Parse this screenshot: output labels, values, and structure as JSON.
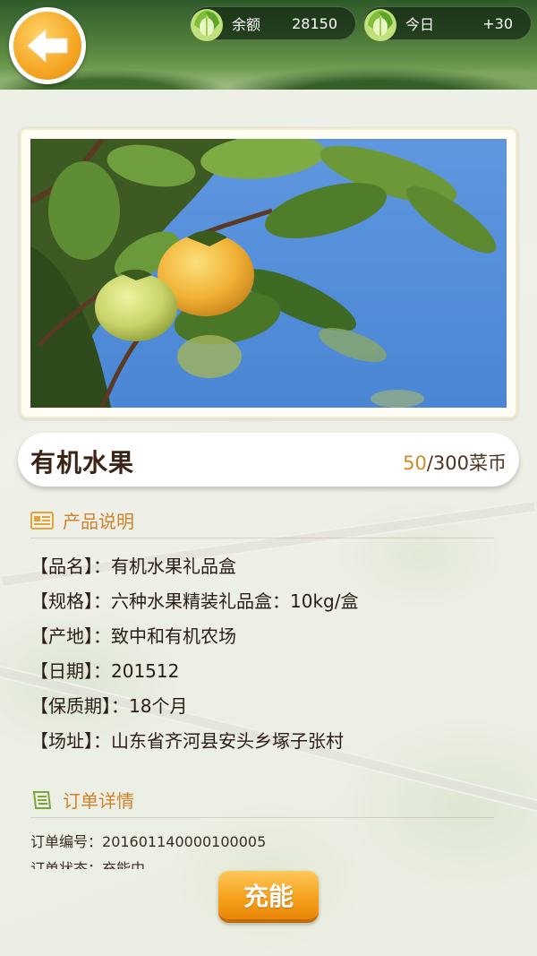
{
  "header": {
    "balance_label": "余额",
    "balance_value": "28150",
    "today_label": "今日",
    "today_value": "+30"
  },
  "product": {
    "name": "有机水果",
    "price_current": "50",
    "price_rest": "/300菜币"
  },
  "description": {
    "title": "产品说明",
    "rows": [
      {
        "key": "【品名】",
        "value": "有机水果礼品盒"
      },
      {
        "key": "【规格】",
        "value": "六种水果精装礼品盒：10kg/盒"
      },
      {
        "key": "【产地】",
        "value": "致中和有机农场"
      },
      {
        "key": "【日期】",
        "value": "201512"
      },
      {
        "key": "【保质期】",
        "value": "18个月"
      },
      {
        "key": "【场址】",
        "value": "山东省齐河县安头乡塚子张村"
      }
    ]
  },
  "order": {
    "title": "订单详情",
    "number_label": "订单编号：",
    "number_value": "201601140000100005",
    "status_label": "订单状态：",
    "status_value": "充能中"
  },
  "actions": {
    "charge_label": "充能"
  },
  "colors": {
    "accent": "#d0822a",
    "button": "#f6a21c"
  }
}
